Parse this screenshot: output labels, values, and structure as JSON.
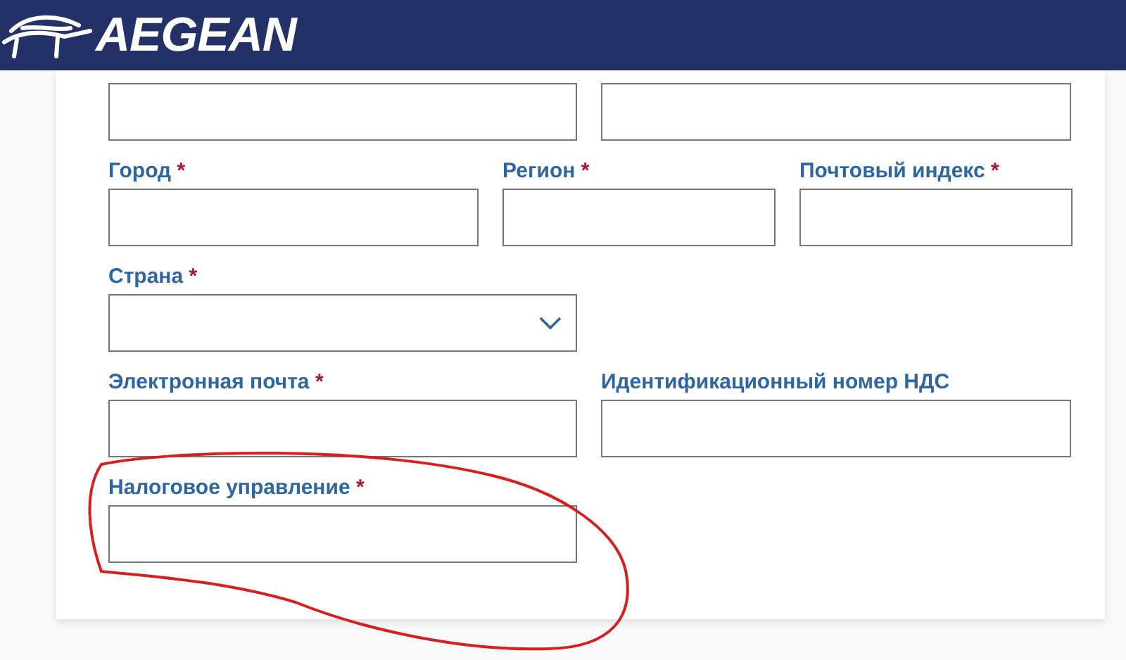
{
  "header": {
    "logo_text": "AEGEAN"
  },
  "form": {
    "rows": [
      {
        "fields": [
          {
            "kind": "text"
          },
          {
            "kind": "text"
          }
        ]
      },
      {
        "fields": [
          {
            "kind": "text",
            "label": "Город",
            "required_mark": "*"
          },
          {
            "kind": "text",
            "label": "Регион",
            "required_mark": "*"
          },
          {
            "kind": "text",
            "label": "Почтовый индекс",
            "required_mark": "*"
          }
        ]
      },
      {
        "fields": [
          {
            "kind": "select",
            "label": "Страна",
            "required_mark": "*"
          }
        ]
      },
      {
        "fields": [
          {
            "kind": "text",
            "label": "Электронная почта",
            "required_mark": "*"
          },
          {
            "kind": "text",
            "label": "Идентификационный номер НДС"
          }
        ]
      },
      {
        "fields": [
          {
            "kind": "text",
            "label": "Налоговое управление",
            "required_mark": "*"
          }
        ]
      }
    ]
  }
}
